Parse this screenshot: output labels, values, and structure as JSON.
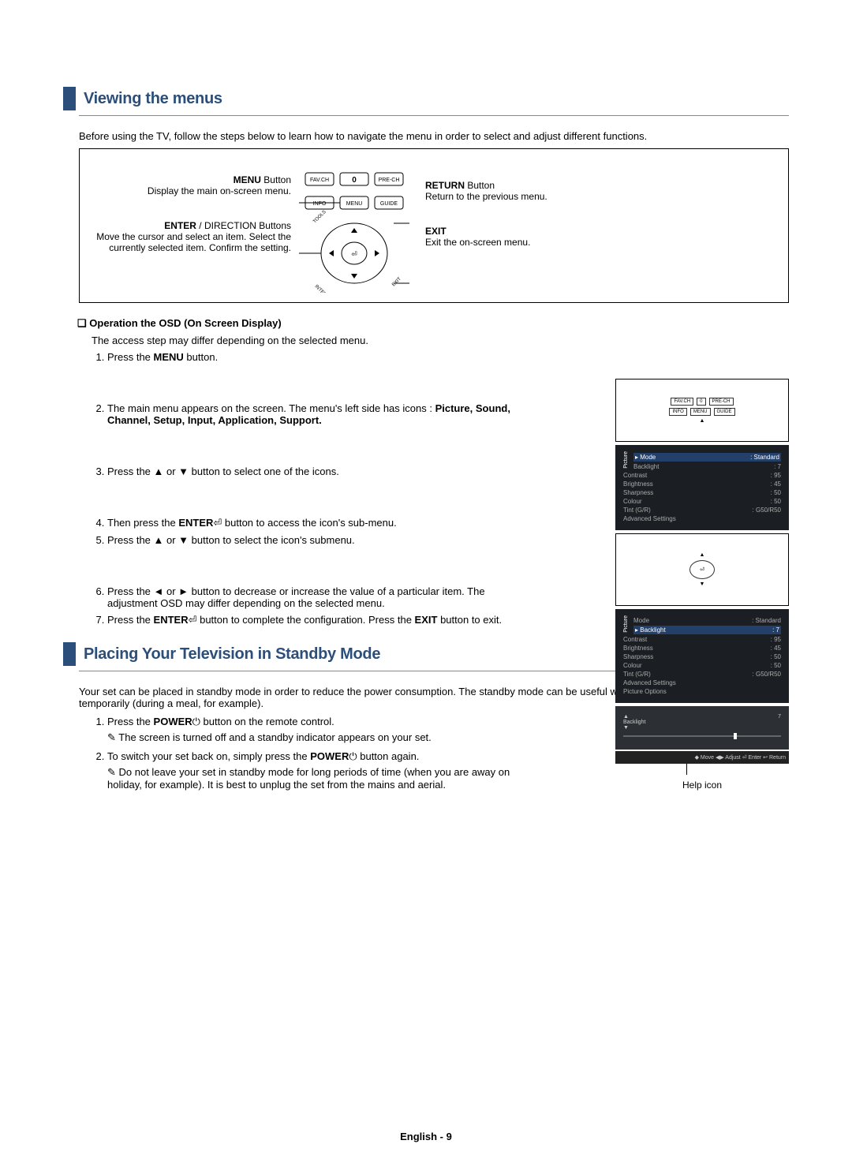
{
  "sections": {
    "view_menus": {
      "title": "Viewing the menus",
      "intro": "Before using the TV, follow the steps below to learn how to navigate the menu in order to select and adjust different functions.",
      "diagram": {
        "menu_label": "MENU",
        "menu_text": " Button",
        "menu_desc": "Display the main on-screen menu.",
        "enter_label": "ENTER",
        "enter_suffix": " / DIRECTION Buttons",
        "enter_desc1": "Move the cursor and select an item. Select the currently selected item. Confirm the setting.",
        "return_label": "RETURN",
        "return_text": " Button",
        "return_desc": "Return to the previous menu.",
        "exit_label": "EXIT",
        "exit_desc": "Exit the on-screen menu.",
        "remote_btns": {
          "favch": "FAV.CH",
          "zero": "0",
          "prech": "PRE-CH",
          "info": "INFO",
          "menu": "MENU",
          "guide": "GUIDE",
          "internet": "INTERNET",
          "tools": "TOOLS",
          "exit": "EXIT"
        }
      },
      "osd_head": "Operation the OSD (On Screen Display)",
      "osd_intro": "The access step may differ depending on the selected menu.",
      "steps": [
        "Press the MENU button.",
        "The main menu appears on the screen. The menu's left side has icons : Picture, Sound, Channel, Setup, Input, Application, Support.",
        "Press the ▲ or ▼ button to select one of the icons.",
        "Then press the ENTER⏎ button to access the icon's sub-menu.",
        "Press the ▲ or ▼ button to select the icon's submenu.",
        "Press the ◄ or ► button to decrease or increase the value of a particular item. The adjustment OSD may differ depending on the selected menu.",
        "Press the ENTER⏎ button to complete the configuration. Press the EXIT button to exit."
      ]
    },
    "standby": {
      "title": "Placing Your Television in Standby Mode",
      "intro": "Your set can be placed in standby mode in order to reduce the power consumption. The standby mode can be useful when you wish to interrupt viewing temporarily (during a meal, for example).",
      "steps": [
        {
          "text": "Press the POWER⏻ button on the remote control.",
          "note": "The screen is turned off and a standby indicator appears on your set."
        },
        {
          "text": "To switch your set back on, simply press the POWER⏻ button again.",
          "note": "Do not leave your set in standby mode for long periods of time (when you are away on holiday, for example). It is best to unplug the set from the mains and aerial."
        }
      ]
    }
  },
  "side": {
    "mini_remote_btns": {
      "favch": "FAV.CH",
      "zero": "0",
      "prech": "PRE-CH",
      "info": "INFO",
      "menu": "MENU",
      "guide": "GUIDE"
    },
    "panel_side_label": "Picture",
    "osd1": {
      "rows": [
        {
          "lbl": "▸ Mode",
          "val": ": Standard",
          "hl": true
        },
        {
          "lbl": "Backlight",
          "val": ": 7"
        },
        {
          "lbl": "Contrast",
          "val": ": 95"
        },
        {
          "lbl": "Brightness",
          "val": ": 45"
        },
        {
          "lbl": "Sharpness",
          "val": ": 50"
        },
        {
          "lbl": "Colour",
          "val": ": 50"
        },
        {
          "lbl": "Tint (G/R)",
          "val": ": G50/R50"
        },
        {
          "lbl": "Advanced Settings",
          "val": ""
        }
      ]
    },
    "osd2": {
      "rows": [
        {
          "lbl": "Mode",
          "val": ": Standard"
        },
        {
          "lbl": "▸ Backlight",
          "val": ": 7",
          "hl": true
        },
        {
          "lbl": "Contrast",
          "val": ": 95"
        },
        {
          "lbl": "Brightness",
          "val": ": 45"
        },
        {
          "lbl": "Sharpness",
          "val": ": 50"
        },
        {
          "lbl": "Colour",
          "val": ": 50"
        },
        {
          "lbl": "Tint (G/R)",
          "val": ": G50/R50"
        },
        {
          "lbl": "Advanced Settings",
          "val": ""
        },
        {
          "lbl": "Picture Options",
          "val": ""
        }
      ]
    },
    "slider": {
      "label": "Backlight",
      "value": "7",
      "hints": "◆ Move  ◀▶ Adjust  ⏎ Enter  ↩ Return"
    },
    "help_icon_label": "Help icon"
  },
  "footer": "English - 9"
}
